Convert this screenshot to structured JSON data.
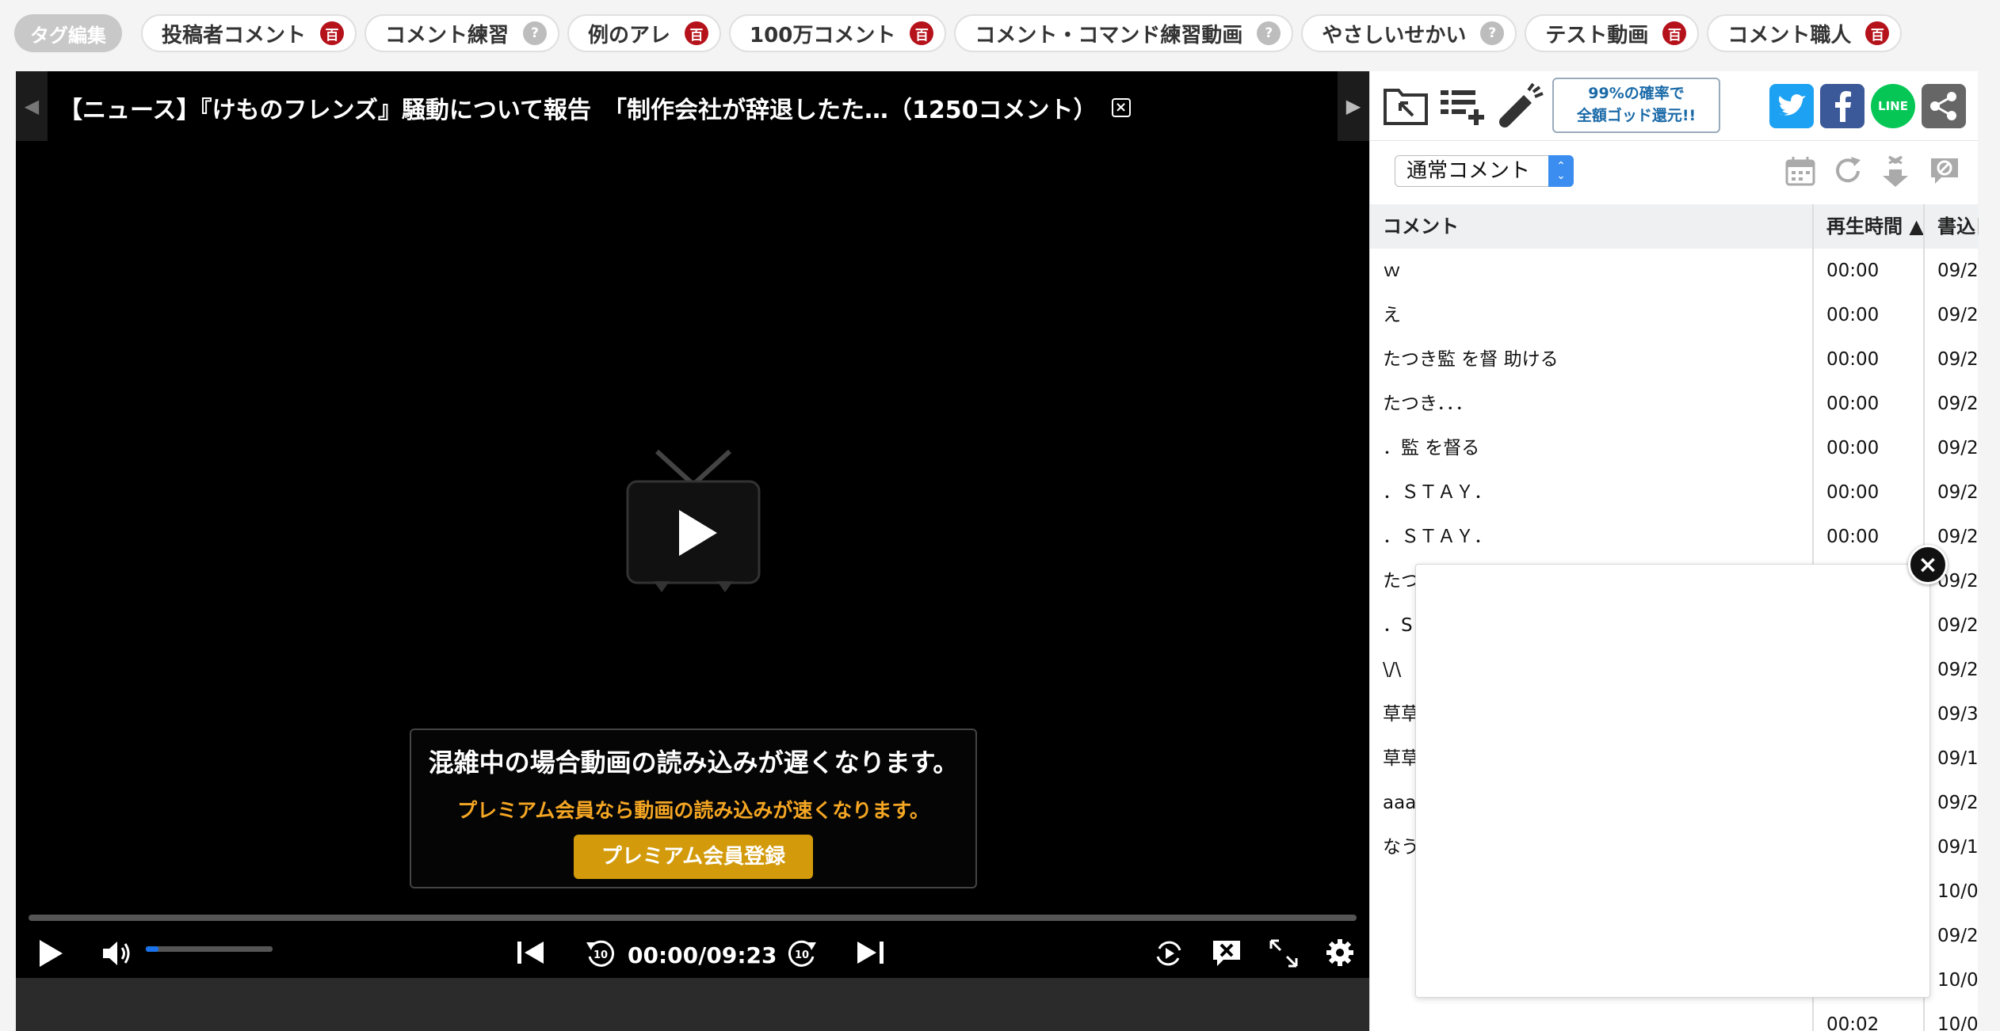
{
  "tagbar": {
    "edit_label": "タグ編集",
    "tags": [
      {
        "label": "投稿者コメント",
        "badge": "百",
        "badge_type": "dic"
      },
      {
        "label": "コメント練習",
        "badge": "?",
        "badge_type": "q"
      },
      {
        "label": "例のアレ",
        "badge": "百",
        "badge_type": "dic"
      },
      {
        "label": "100万コメント",
        "badge": "百",
        "badge_type": "dic"
      },
      {
        "label": "コメント・コマンド練習動画",
        "badge": "?",
        "badge_type": "q"
      },
      {
        "label": "やさしいせかい",
        "badge": "?",
        "badge_type": "q"
      },
      {
        "label": "テスト動画",
        "badge": "百",
        "badge_type": "dic"
      },
      {
        "label": "コメント職人",
        "badge": "百",
        "badge_type": "dic"
      }
    ]
  },
  "player": {
    "title": "【ニュース】『けものフレンズ』騒動について報告　「制作会社が辞退したた…（1250コメント）",
    "notice": {
      "main": "混雑中の場合動画の読み込みが遅くなります。",
      "sub": "プレミアム会員なら動画の読み込みが速くなります。",
      "button": "プレミアム会員登録"
    },
    "timecode": "00:00/09:23",
    "seek_progress": 0,
    "volume_level": 0.1
  },
  "side": {
    "promo": "99%の確率で\n全額ゴッド還元!!",
    "social_line": "LINE",
    "filter_select": "通常コメント",
    "table": {
      "headers": [
        "コメント",
        "再生時間 ▲",
        "書込日時"
      ],
      "rows": [
        [
          "ｗ",
          "00:00",
          "09/2"
        ],
        [
          "え",
          "00:00",
          "09/2"
        ],
        [
          "たつき監 を督 助ける",
          "00:00",
          "09/2"
        ],
        [
          "たつき．．．",
          "00:00",
          "09/2"
        ],
        [
          "．監 を督る",
          "00:00",
          "09/2"
        ],
        [
          "．ＳＴＡＹ．",
          "00:00",
          "09/2"
        ],
        [
          "．ＳＴＡＹ．",
          "00:00",
          "09/2"
        ],
        [
          "たつ",
          "",
          "09/2"
        ],
        [
          "．S",
          "",
          "09/2"
        ],
        [
          "\\/\\",
          "",
          "09/2"
        ],
        [
          "草草",
          "",
          "09/3"
        ],
        [
          "草草",
          "",
          "09/1"
        ],
        [
          "aaa",
          "",
          "09/2"
        ],
        [
          "なう",
          "",
          "09/1"
        ],
        [
          "",
          "",
          "10/0"
        ],
        [
          "",
          "",
          "09/2"
        ],
        [
          "",
          "",
          "10/0"
        ],
        [
          "",
          "00:02",
          "10/0"
        ]
      ]
    }
  },
  "colors": {
    "accent_blue": "#3b8ef0",
    "dic_badge": "#b5121b",
    "premium_gold": "#d39b0b",
    "premium_text": "#f5a623"
  }
}
